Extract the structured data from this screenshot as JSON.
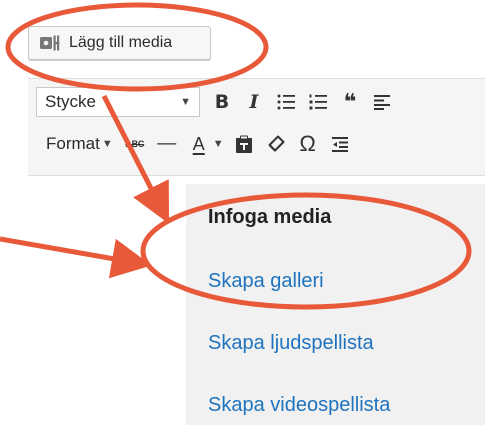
{
  "media_button": {
    "label": "Lägg till media",
    "icon": "add-media-icon"
  },
  "toolbar": {
    "format_select": {
      "selected": "Stycke"
    },
    "row1_icons": [
      "bold-icon",
      "italic-icon",
      "bulleted-list-icon",
      "numbered-list-icon",
      "blockquote-icon",
      "align-left-icon"
    ],
    "bold_label": "B",
    "italic_label": "I",
    "quote_label": "❝",
    "format_label": "Format",
    "strikethrough_label": "ABC",
    "horizontal_rule_label": "—",
    "text_color_label": "A",
    "omega_label": "Ω",
    "row2_icons": [
      "strikethrough-icon",
      "horizontal-rule-icon",
      "text-color-icon",
      "paste-as-text-icon",
      "clear-formatting-icon",
      "special-character-icon",
      "outdent-icon"
    ]
  },
  "menu": {
    "items": [
      {
        "label": "Infoga media",
        "active": true
      },
      {
        "label": "Skapa galleri",
        "active": false
      },
      {
        "label": "Skapa ljudspellista",
        "active": false
      },
      {
        "label": "Skapa videospellista",
        "active": false
      }
    ]
  },
  "colors": {
    "annotation": "#e8593a",
    "link": "#1e73be",
    "menu_bg": "#f1f1f1",
    "toolbar_bg": "#f5f5f5"
  }
}
